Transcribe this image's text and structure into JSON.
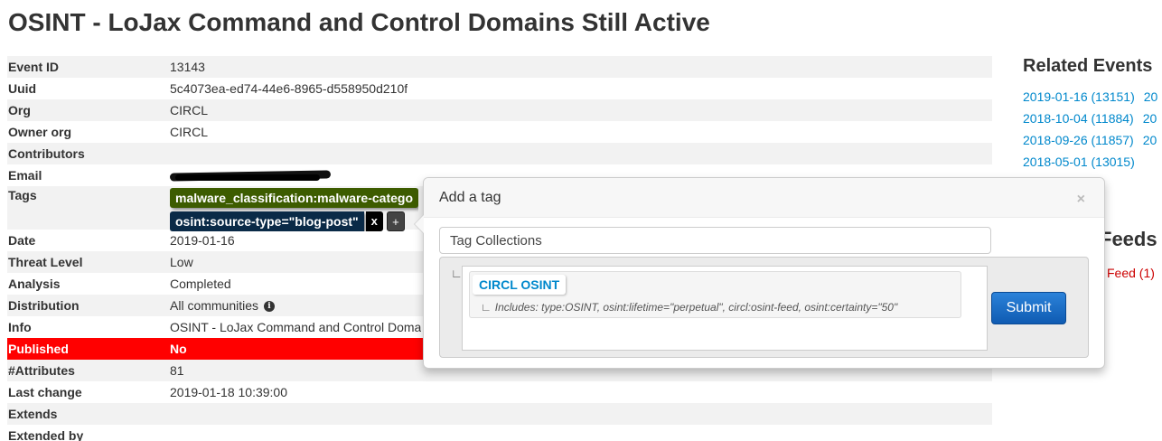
{
  "page": {
    "title": "OSINT - LoJax Command and Control Domains Still Active"
  },
  "event": {
    "event_id_label": "Event ID",
    "event_id": "13143",
    "uuid_label": "Uuid",
    "uuid": "5c4073ea-ed74-44e6-8965-d558950d210f",
    "org_label": "Org",
    "org": "CIRCL",
    "owner_org_label": "Owner org",
    "owner_org": "CIRCL",
    "contributors_label": "Contributors",
    "contributors": "",
    "email_label": "Email",
    "email_visible_fragment": "",
    "tags_label": "Tags",
    "tags": [
      {
        "text": "malware_classification:malware-catego",
        "color": "#3d5c00"
      },
      {
        "text": "osint:source-type=\"blog-post\"",
        "color": "#0a2a47",
        "remove": "x"
      }
    ],
    "add_tag_symbol": "+",
    "date_label": "Date",
    "date": "2019-01-16",
    "threat_level_label": "Threat Level",
    "threat_level": "Low",
    "analysis_label": "Analysis",
    "analysis": "Completed",
    "distribution_label": "Distribution",
    "distribution": "All communities",
    "distribution_info_icon": "i",
    "info_label": "Info",
    "info": "OSINT - LoJax Command and Control Doma",
    "published_label": "Published",
    "published": "No",
    "attributes_label": "#Attributes",
    "attributes": "81",
    "last_change_label": "Last change",
    "last_change": "2019-01-18 10:39:00",
    "extends_label": "Extends",
    "extends": "",
    "extended_by_label": "Extended by"
  },
  "related": {
    "heading": "Related Events",
    "items": [
      {
        "label": "2019-01-16 (13151)",
        "more": "20"
      },
      {
        "label": "2018-10-04 (11884)",
        "more": "20"
      },
      {
        "label": "2018-09-26 (11857)",
        "more": "20"
      },
      {
        "label": "2018-05-01 (13015)",
        "more": ""
      }
    ],
    "partial_item": ")"
  },
  "feeds": {
    "heading": "Feeds",
    "item": "Feed (1)"
  },
  "popover": {
    "title": "Add a tag",
    "close": "×",
    "select_value": "Tag Collections",
    "corner_glyph": "∟",
    "collection_name": "CIRCL OSINT",
    "collection_desc": "Includes: type:OSINT, osint:lifetime=\"perpetual\", circl:osint-feed, osint:certainty=\"50\"",
    "submit_label": "Submit"
  },
  "colors": {
    "link": "#0088cc",
    "published_bg": "#ff0000",
    "submit_bg": "#1f6fc5"
  }
}
